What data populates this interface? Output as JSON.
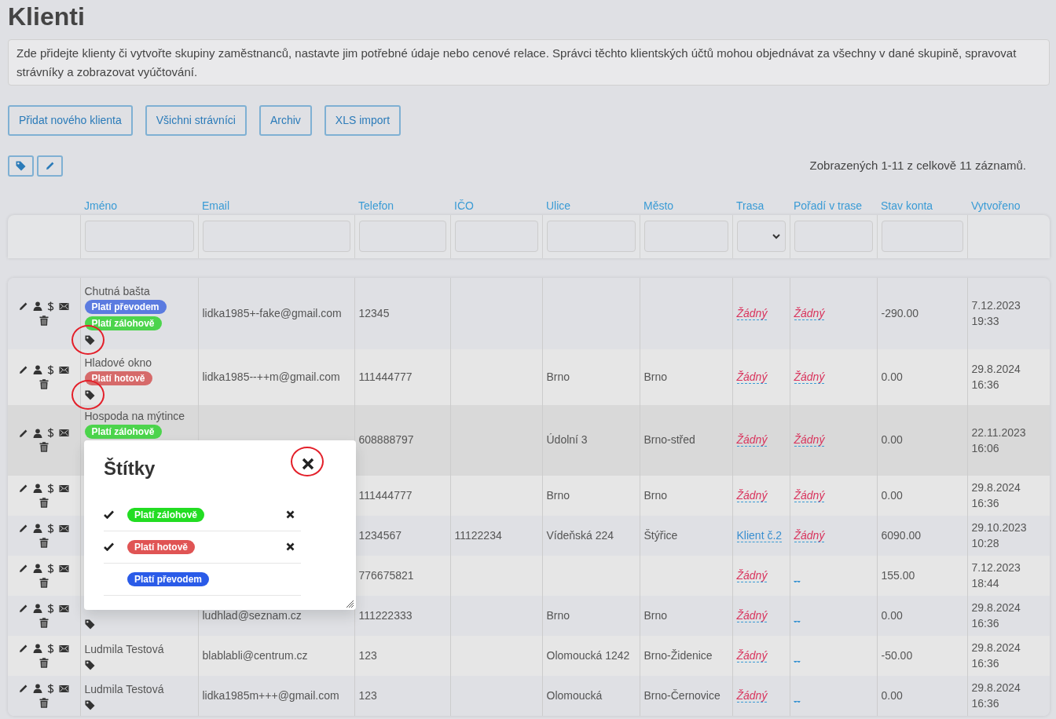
{
  "page": {
    "title": "Klienti",
    "info": "Zde přidejte klienty či vytvořte skupiny zaměstnanců, nastavte jim potřebné údaje nebo cenové relace. Správci těchto klientských účtů mohou objednávat za všechny v dané skupině, spravovat strávníky a zobrazovat vyúčtování.",
    "buttons": [
      "Přidat nového klienta",
      "Všichni strávníci",
      "Archiv",
      "XLS import"
    ],
    "record_count": "Zobrazených 1-11 z celkově 11 záznamů."
  },
  "table": {
    "columns": [
      {
        "label": "Jméno",
        "kind": "input"
      },
      {
        "label": "Email",
        "kind": "input"
      },
      {
        "label": "Telefon",
        "kind": "input"
      },
      {
        "label": "IČO",
        "kind": "input"
      },
      {
        "label": "Ulice",
        "kind": "input"
      },
      {
        "label": "Město",
        "kind": "input"
      },
      {
        "label": "Trasa",
        "kind": "select"
      },
      {
        "label": "Pořadí v trase",
        "kind": "input"
      },
      {
        "label": "Stav konta",
        "kind": "input"
      },
      {
        "label": "Vytvořeno",
        "kind": "plain"
      }
    ],
    "rows": [
      {
        "name": "Chutná bašta",
        "tags": [
          {
            "label": "Platí převodem",
            "color": "#5b7be0"
          },
          {
            "label": "Platí zálohově",
            "color": "#4cd44c"
          }
        ],
        "tag_icon": true,
        "highlighted": true,
        "hovered": false,
        "email": "lidka1985+-fake@gmail.com",
        "phone": "12345",
        "route": {
          "text": "Žádný",
          "kind": "none"
        },
        "order": {
          "text": "Žádný",
          "kind": "none"
        },
        "balance": "-290.00",
        "created_date": "7.12.2023",
        "created_time": "19:33"
      },
      {
        "name": "Hladové okno",
        "tags": [
          {
            "label": "Platí hotově",
            "color": "#d66a6a"
          }
        ],
        "tag_icon": true,
        "highlighted": true,
        "hovered": false,
        "email": "lidka1985--++m@gmail.com",
        "phone": "111444777",
        "street": "Brno",
        "city": "Brno",
        "route": {
          "text": "Žádný",
          "kind": "none"
        },
        "order": {
          "text": "Žádný",
          "kind": "none"
        },
        "balance": "0.00",
        "created_date": "29.8.2024",
        "created_time": "16:36"
      },
      {
        "name": "Hospoda na mýtince",
        "tags": [
          {
            "label": "Platí zálohově",
            "color": "#4cd44c"
          }
        ],
        "tag_icon": false,
        "highlighted": false,
        "hovered": true,
        "phone": "608888797",
        "street": "Údolní 3",
        "city": "Brno-střed",
        "route": {
          "text": "Žádný",
          "kind": "none"
        },
        "order": {
          "text": "Žádný",
          "kind": "none"
        },
        "balance": "0.00",
        "created_date": "22.11.2023",
        "created_time": "16:06"
      },
      {
        "tags": [],
        "tag_icon": false,
        "highlighted": false,
        "hovered": false,
        "phone": "111444777",
        "street": "Brno",
        "city": "Brno",
        "route": {
          "text": "Žádný",
          "kind": "none"
        },
        "order": {
          "text": "Žádný",
          "kind": "none"
        },
        "balance": "0.00",
        "created_date": "29.8.2024",
        "created_time": "16:36"
      },
      {
        "tags": [],
        "tag_icon": false,
        "highlighted": false,
        "hovered": false,
        "phone": "1234567",
        "ico": "11122234",
        "street": "Vídeňská 224",
        "city": "Štýřice",
        "route": {
          "text": "Klient č.2",
          "kind": "set"
        },
        "order": {
          "text": "Žádný",
          "kind": "none"
        },
        "balance": "6090.00",
        "created_date": "29.10.2023",
        "created_time": "10:28"
      },
      {
        "tags": [],
        "tag_icon": false,
        "highlighted": false,
        "hovered": false,
        "phone": "776675821",
        "route": {
          "text": "Žádný",
          "kind": "none"
        },
        "order": {
          "text": "_",
          "kind": "set"
        },
        "balance": "155.00",
        "created_date": "7.12.2023",
        "created_time": "18:44"
      },
      {
        "tags": [],
        "tag_icon": true,
        "highlighted": false,
        "hovered": false,
        "email": "ludhlad@seznam.cz",
        "phone": "111222333",
        "street": "Brno",
        "city": "Brno",
        "route": {
          "text": "Žádný",
          "kind": "none"
        },
        "order": {
          "text": "_",
          "kind": "set"
        },
        "balance": "0.00",
        "created_date": "29.8.2024",
        "created_time": "16:36"
      },
      {
        "name": "Ludmila Testová",
        "tags": [],
        "tag_icon": true,
        "highlighted": false,
        "hovered": false,
        "email": "blablabli@centrum.cz",
        "phone": "123",
        "street": "Olomoucká 1242",
        "city": "Brno-Židenice",
        "route": {
          "text": "Žádný",
          "kind": "none"
        },
        "order": {
          "text": "_",
          "kind": "set"
        },
        "balance": "-50.00",
        "created_date": "29.8.2024",
        "created_time": "16:36"
      },
      {
        "name": "Ludmila Testová",
        "tags": [],
        "tag_icon": true,
        "highlighted": false,
        "hovered": false,
        "email": "lidka1985m+++@gmail.com",
        "phone": "123",
        "street": "Olomoucká",
        "city": "Brno-Černovice",
        "route": {
          "text": "Žádný",
          "kind": "none"
        },
        "order": {
          "text": "_",
          "kind": "set"
        },
        "balance": "0.00",
        "created_date": "29.8.2024",
        "created_time": "16:36"
      }
    ]
  },
  "tags_dialog": {
    "title": "Štítky",
    "close_highlighted": true,
    "items": [
      {
        "label": "Platí zálohově",
        "color": "#22dd22",
        "checked": true
      },
      {
        "label": "Platí hotově",
        "color": "#e05454",
        "checked": true
      },
      {
        "label": "Platí převodem",
        "color": "#2a5be8",
        "checked": false
      }
    ]
  }
}
